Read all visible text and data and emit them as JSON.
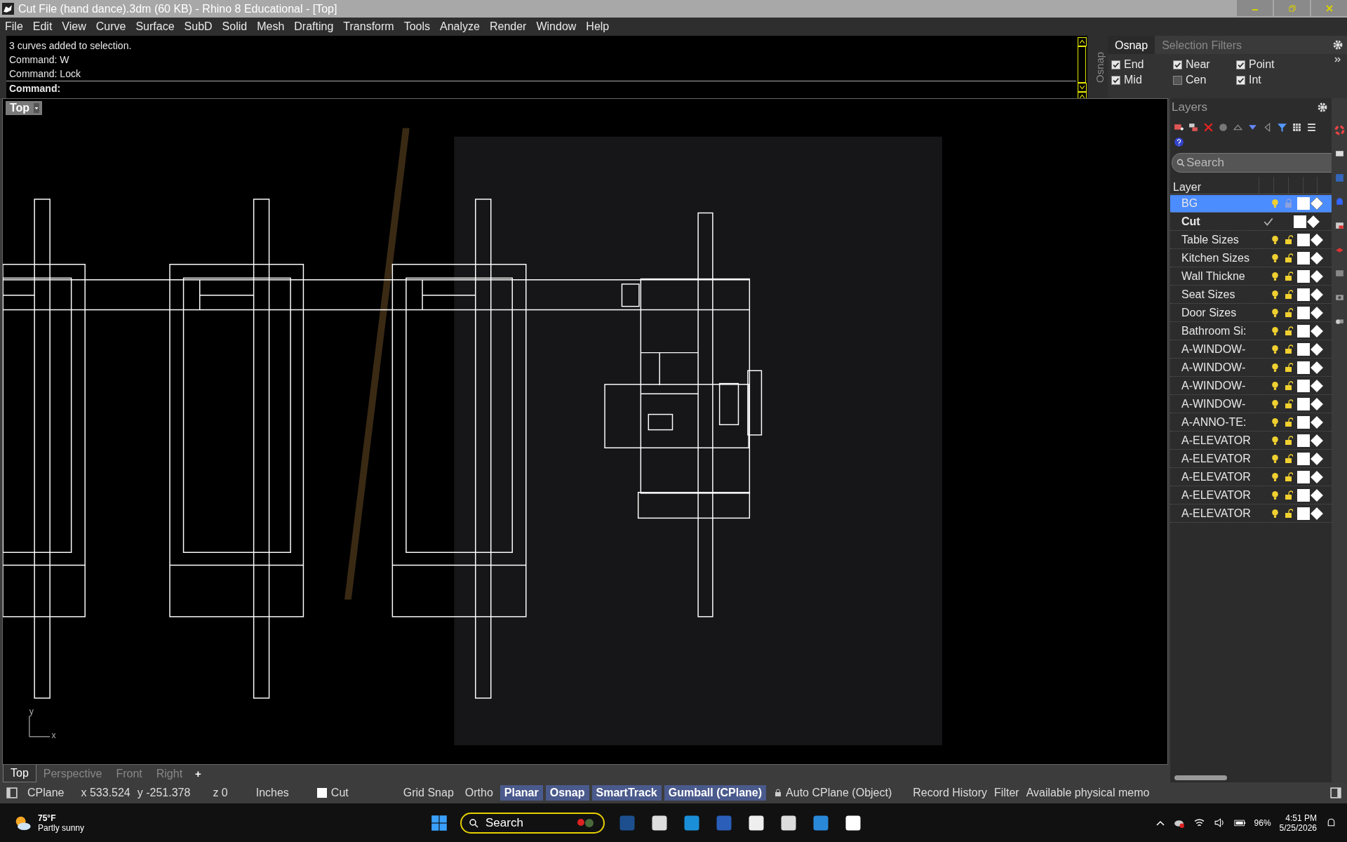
{
  "window": {
    "title": "Cut File (hand dance).3dm (60 KB) - Rhino 8 Educational - [Top]"
  },
  "menu": [
    "File",
    "Edit",
    "View",
    "Curve",
    "Surface",
    "SubD",
    "Solid",
    "Mesh",
    "Drafting",
    "Transform",
    "Tools",
    "Analyze",
    "Render",
    "Window",
    "Help"
  ],
  "command_history": [
    "3 curves added to selection.",
    "Command: W",
    "Command: Lock"
  ],
  "command_prompt": "Command:",
  "osnap_panel": {
    "side_label": "Osnap",
    "tabs": [
      {
        "label": "Osnap",
        "selected": true
      },
      {
        "label": "Selection Filters",
        "selected": false
      }
    ],
    "items": [
      {
        "label": "End",
        "checked": true
      },
      {
        "label": "Near",
        "checked": true
      },
      {
        "label": "Point",
        "checked": true
      },
      {
        "label": "Mid",
        "checked": true
      },
      {
        "label": "Cen",
        "checked": false
      },
      {
        "label": "Int",
        "checked": true
      }
    ]
  },
  "viewport": {
    "label": "Top",
    "axis_y": "y",
    "axis_x": "x"
  },
  "viewport_tabs": [
    {
      "label": "Top",
      "selected": true
    },
    {
      "label": "Perspective",
      "selected": false
    },
    {
      "label": "Front",
      "selected": false
    },
    {
      "label": "Right",
      "selected": false
    }
  ],
  "add_tab": "+",
  "layers_panel": {
    "title": "Layers",
    "search": {
      "placeholder": "Search"
    },
    "column": "Layer",
    "rows": [
      {
        "name": "BG",
        "selected": true,
        "current": false,
        "locked": true
      },
      {
        "name": "Cut",
        "selected": false,
        "current": true
      },
      {
        "name": "Table Sizes",
        "selected": false,
        "current": false,
        "locked": false
      },
      {
        "name": "Kitchen Sizes",
        "selected": false,
        "current": false,
        "locked": false
      },
      {
        "name": "Wall Thickne",
        "selected": false,
        "current": false,
        "locked": false
      },
      {
        "name": "Seat Sizes",
        "selected": false,
        "current": false,
        "locked": false
      },
      {
        "name": "Door Sizes",
        "selected": false,
        "current": false,
        "locked": false
      },
      {
        "name": "Bathroom Si:",
        "selected": false,
        "current": false,
        "locked": false
      },
      {
        "name": "A-WINDOW-",
        "selected": false,
        "current": false,
        "locked": false
      },
      {
        "name": "A-WINDOW-",
        "selected": false,
        "current": false,
        "locked": false
      },
      {
        "name": "A-WINDOW-",
        "selected": false,
        "current": false,
        "locked": false
      },
      {
        "name": "A-WINDOW-",
        "selected": false,
        "current": false,
        "locked": false
      },
      {
        "name": "A-ANNO-TE:",
        "selected": false,
        "current": false,
        "locked": false
      },
      {
        "name": "A-ELEVATOR",
        "selected": false,
        "current": false,
        "locked": false
      },
      {
        "name": "A-ELEVATOR",
        "selected": false,
        "current": false,
        "locked": false
      },
      {
        "name": "A-ELEVATOR",
        "selected": false,
        "current": false,
        "locked": false
      },
      {
        "name": "A-ELEVATOR",
        "selected": false,
        "current": false,
        "locked": false
      },
      {
        "name": "A-ELEVATOR",
        "selected": false,
        "current": false,
        "locked": false
      }
    ]
  },
  "status_bar": {
    "cplane": "CPlane",
    "x": "x 533.524",
    "y": "y -251.378",
    "z": "z 0",
    "units": "Inches",
    "layer": "Cut",
    "toggles": [
      {
        "label": "Grid Snap",
        "on": false
      },
      {
        "label": "Ortho",
        "on": false
      },
      {
        "label": "Planar",
        "on": true
      },
      {
        "label": "Osnap",
        "on": true
      },
      {
        "label": "SmartTrack",
        "on": true
      },
      {
        "label": "Gumball (CPlane)",
        "on": true
      }
    ],
    "auto_cplane": "Auto CPlane (Object)",
    "record_history": "Record History",
    "filter": "Filter",
    "memory": "Available physical memo"
  },
  "taskbar": {
    "temperature": "75°F",
    "weather": "Partly sunny",
    "search": "Search",
    "battery": "96%",
    "time": "4:51 PM",
    "date": "5/25/2026"
  }
}
